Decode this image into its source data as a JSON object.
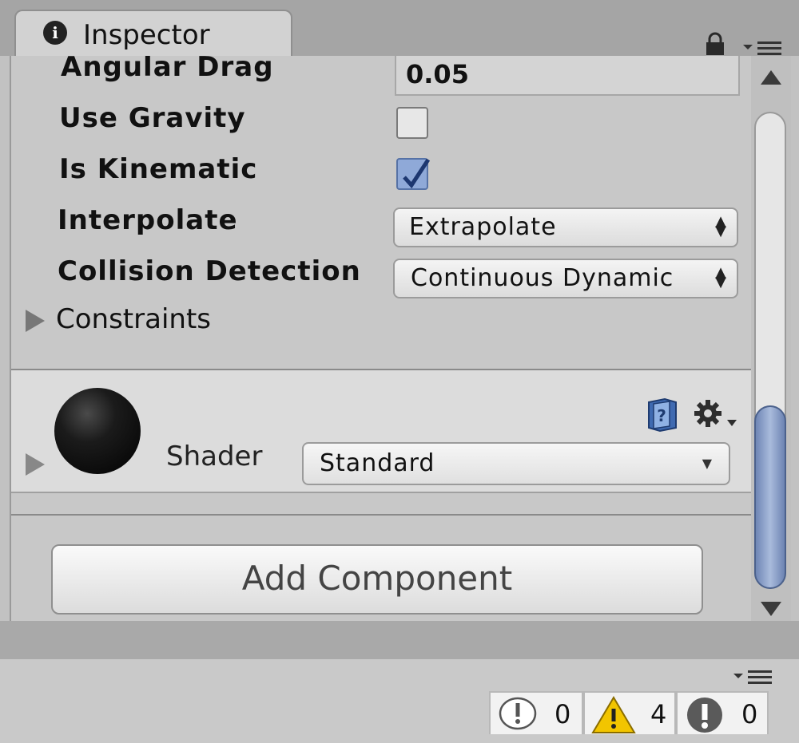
{
  "window": {
    "tab_title": "Inspector",
    "tab_icon": "info-icon"
  },
  "rigidbody": {
    "angular_drag": {
      "label": "Angular Drag",
      "value": "0.05"
    },
    "use_gravity": {
      "label": "Use Gravity",
      "checked": false
    },
    "is_kinematic": {
      "label": "Is Kinematic",
      "checked": true
    },
    "interpolate": {
      "label": "Interpolate",
      "value": "Extrapolate"
    },
    "collision_detection": {
      "label": "Collision Detection",
      "value": "Continuous Dynamic"
    },
    "constraints": {
      "label": "Constraints"
    }
  },
  "material": {
    "shader_label": "Shader",
    "shader_value": "Standard"
  },
  "actions": {
    "add_component_label": "Add Component"
  },
  "status": {
    "info_count": "0",
    "warning_count": "4",
    "error_count": "0"
  },
  "colors": {
    "panel_bg": "#c8c8c8",
    "scroll_thumb": "#8ea3cd",
    "checkbox_checked": "#8fa9d8",
    "warning_yellow": "#f2c500"
  }
}
